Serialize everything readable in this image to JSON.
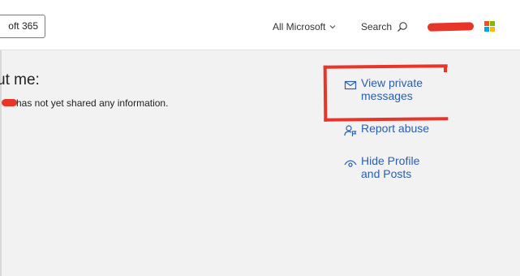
{
  "header": {
    "product_label": "oft 365",
    "all_microsoft_label": "All Microsoft",
    "search_label": "Search"
  },
  "about": {
    "heading": "ut me:",
    "text": "has not yet shared any information."
  },
  "actions": {
    "view_private_messages": "View private\nmessages",
    "report_abuse": "Report abuse",
    "hide_profile_and_posts": "Hide Profile\nand Posts"
  },
  "colors": {
    "link": "#2b5eb0",
    "annotation_red": "#e8352a",
    "background": "#f2f2f2"
  },
  "icons": {
    "all_microsoft": "chevron-down-icon",
    "search": "search-icon",
    "view_private_messages": "envelope-icon",
    "report_abuse": "report-person-icon",
    "hide_profile": "eye-icon",
    "brand": "microsoft-logo-icon"
  }
}
